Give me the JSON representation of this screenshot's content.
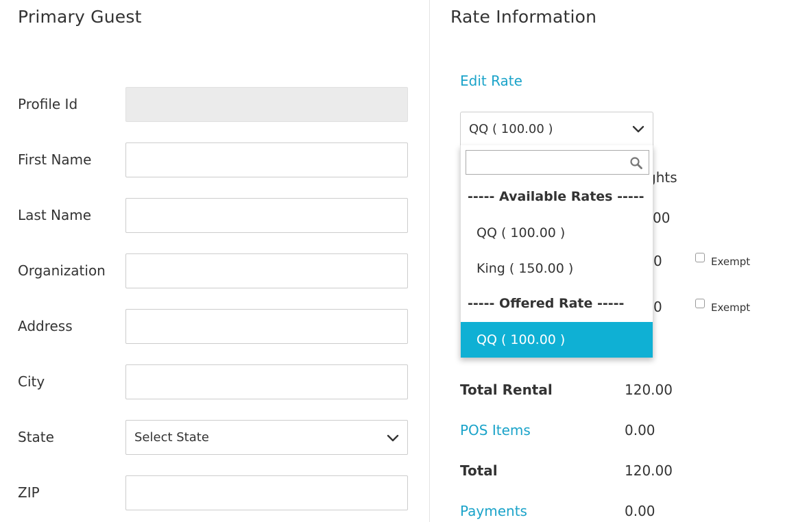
{
  "primary_guest": {
    "title": "Primary Guest",
    "fields": {
      "profile_id": {
        "label": "Profile Id",
        "value": ""
      },
      "first_name": {
        "label": "First Name",
        "value": ""
      },
      "last_name": {
        "label": "Last Name",
        "value": ""
      },
      "organization": {
        "label": "Organization",
        "value": ""
      },
      "address": {
        "label": "Address",
        "value": ""
      },
      "city": {
        "label": "City",
        "value": ""
      },
      "state": {
        "label": "State",
        "value": "Select State"
      },
      "zip": {
        "label": "ZIP",
        "value": ""
      }
    }
  },
  "rate_info": {
    "title": "Rate Information",
    "edit_rate_link": "Edit Rate",
    "rate_select_value": "QQ ( 100.00 )",
    "partial_behind": {
      "nights": "ghts",
      "amount1": "00",
      "amount2": "0",
      "amount3": "0"
    },
    "exempt_label": "Exempt",
    "dropdown": {
      "search_value": "",
      "group1": "----- Available Rates -----",
      "options1": [
        "QQ ( 100.00 )",
        "King ( 150.00 )"
      ],
      "group2": "----- Offered Rate -----",
      "options2": [
        "QQ ( 100.00 )"
      ]
    },
    "totals": {
      "total_rental_label": "Total Rental",
      "total_rental_value": "120.00",
      "pos_items_label": "POS Items",
      "pos_items_value": "0.00",
      "total_label": "Total",
      "total_value": "120.00",
      "payments_label": "Payments",
      "payments_value": "0.00"
    }
  },
  "colors": {
    "link": "#1aa3c9",
    "selected_option": "#0fb0d4",
    "readonly_bg": "#ebebeb"
  },
  "icons": {
    "search": "search-icon",
    "chevron": "chevron-down-icon"
  }
}
